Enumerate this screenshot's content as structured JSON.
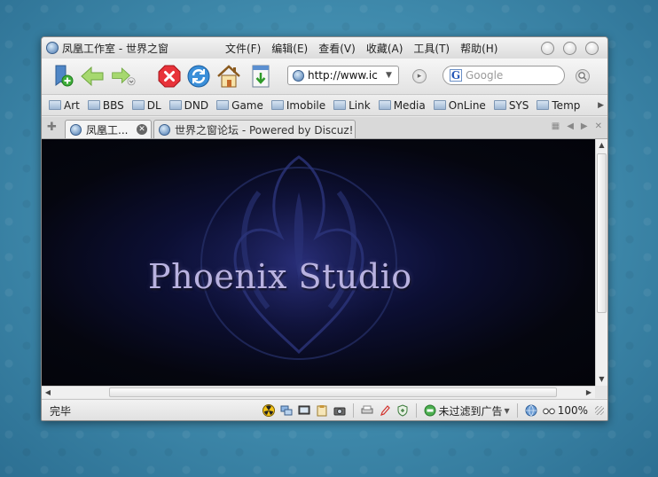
{
  "window": {
    "title": "凤凰工作室 - 世界之窗",
    "menu": [
      "文件(F)",
      "编辑(E)",
      "查看(V)",
      "收藏(A)",
      "工具(T)",
      "帮助(H)"
    ]
  },
  "navbar": {
    "address_value": "http://www.ic",
    "search_placeholder": "Google"
  },
  "bookmarks": [
    "Art",
    "BBS",
    "DL",
    "DND",
    "Game",
    "Imobile",
    "Link",
    "Media",
    "OnLine",
    "SYS",
    "Temp"
  ],
  "tabs": [
    {
      "label": "凤凰工...",
      "active": true
    },
    {
      "label": "世界之窗论坛 - Powered by Discuz!",
      "active": false
    }
  ],
  "content": {
    "brand_title": "Phoenix Studio"
  },
  "statusbar": {
    "status": "完毕",
    "filter_label": "未过滤到广告",
    "zoom": "100%"
  },
  "colors": {
    "background": "#3f8aac",
    "viewport": "#05060f",
    "title_text": "#b9b2e0"
  },
  "icons": {
    "nav": [
      "bookmark-add-icon",
      "back-arrow-icon",
      "forward-arrow-icon",
      "stop-icon",
      "refresh-icon",
      "home-icon",
      "download-icon"
    ],
    "status": [
      "radiation-icon",
      "network-icon",
      "screen-icon",
      "clipboard-icon",
      "camera-icon",
      "print-icon",
      "pen-icon",
      "shield-icon",
      "filter-icon",
      "globe-icon",
      "zoom-glasses-icon"
    ]
  }
}
